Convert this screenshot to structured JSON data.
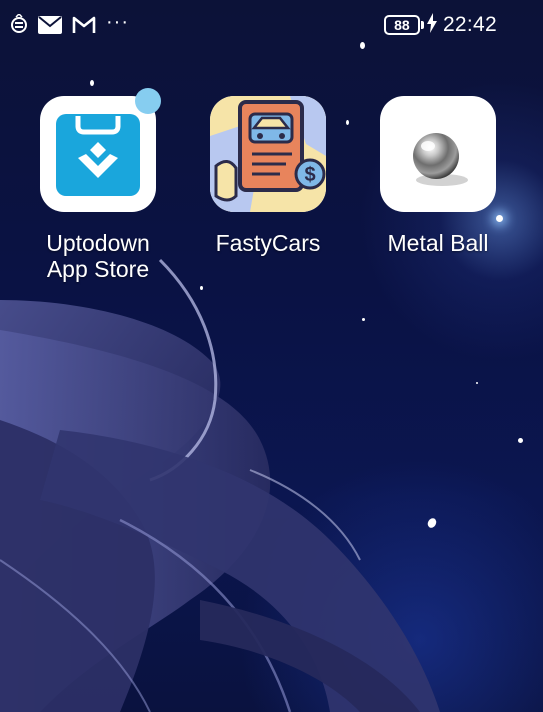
{
  "status_bar": {
    "left_icons": [
      "sim-card-icon",
      "mail-icon",
      "gmail-icon",
      "more-icon"
    ],
    "more_label": "···",
    "battery_level": "88",
    "charging_icon": "bolt-icon",
    "time": "22:42"
  },
  "apps": [
    {
      "label_line1": "Uptodown",
      "label_line2": "App Store",
      "icon": "uptodown-bag-icon",
      "accent": "#1aa6dc",
      "has_notification": true
    },
    {
      "label_line1": "FastyCars",
      "label_line2": "",
      "icon": "fastycars-car-icon",
      "accent": "#e8845c"
    },
    {
      "label_line1": "Metal Ball",
      "label_line2": "",
      "icon": "metal-ball-icon",
      "accent": "#9a9a9a"
    }
  ],
  "colors": {
    "wallpaper_dark": "#0c1238",
    "notification_dot": "#86cdf0",
    "hair": "#3a3f7a"
  }
}
